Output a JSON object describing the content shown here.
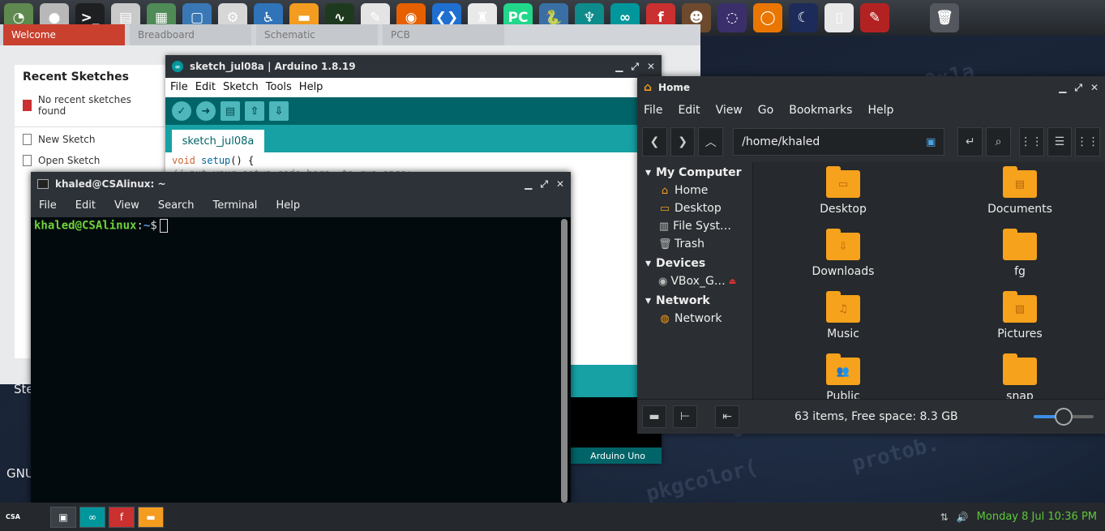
{
  "launcher": {
    "icons": [
      {
        "name": "disk-usage-icon",
        "bg": "#5f8a4f",
        "glyph": "◔"
      },
      {
        "name": "browser-ball-icon",
        "bg": "#b8b8b8",
        "glyph": "●"
      },
      {
        "name": "terminal-app-icon",
        "bg": "#1d1f21",
        "glyph": ">_"
      },
      {
        "name": "file-cabinet-icon",
        "bg": "#c9c9c9",
        "glyph": "▤"
      },
      {
        "name": "calculator-icon",
        "bg": "#4f8a57",
        "glyph": "▦"
      },
      {
        "name": "screenshot-icon",
        "bg": "#3a78b5",
        "glyph": "▢"
      },
      {
        "name": "mixer-icon",
        "bg": "#d7d7d7",
        "glyph": "⚙"
      },
      {
        "name": "accessibility-icon",
        "bg": "#2f73b8",
        "glyph": "♿"
      },
      {
        "name": "folder-app-icon",
        "bg": "#f39c1f",
        "glyph": "▬"
      },
      {
        "name": "system-monitor-icon",
        "bg": "#1e3a1e",
        "glyph": "∿"
      },
      {
        "name": "text-editor-icon",
        "bg": "#e4e4e4",
        "glyph": "✎"
      },
      {
        "name": "firefox-icon",
        "bg": "#e66000",
        "glyph": "◉"
      },
      {
        "name": "vscode-icon",
        "bg": "#1f6fd1",
        "glyph": "❮❯"
      },
      {
        "name": "java-duke-icon",
        "bg": "#e9e9e9",
        "glyph": "♜"
      },
      {
        "name": "pycharm-icon",
        "bg": "#21d789",
        "glyph": "PC"
      },
      {
        "name": "python-icon",
        "bg": "#3a6fa6",
        "glyph": "🐍"
      },
      {
        "name": "kraken-icon",
        "bg": "#0e8b8b",
        "glyph": "♆"
      },
      {
        "name": "arduino-app-icon",
        "bg": "#00979c",
        "glyph": "∞"
      },
      {
        "name": "fritzing-app-icon",
        "bg": "#c9302f",
        "glyph": "f"
      },
      {
        "name": "gnu-emacs-icon",
        "bg": "#6d4a2d",
        "glyph": "☻"
      },
      {
        "name": "node-graph-icon",
        "bg": "#3a2f6b",
        "glyph": "◌"
      },
      {
        "name": "blender-like-icon",
        "bg": "#ea7600",
        "glyph": "◯"
      },
      {
        "name": "stellarium-icon",
        "bg": "#1c2b5a",
        "glyph": "☾"
      },
      {
        "name": "blank-document-icon",
        "bg": "#e8e8e8",
        "glyph": "▯"
      },
      {
        "name": "paint-icon",
        "bg": "#b32222",
        "glyph": "✎"
      },
      {
        "name": "trash-launcher-icon",
        "bg": "#54585e",
        "glyph": "🗑"
      }
    ]
  },
  "fritzing": {
    "tabs": [
      "Welcome",
      "Breadboard",
      "Schematic",
      "PCB"
    ],
    "recent_title": "Recent Sketches",
    "no_recent": "No recent sketches found",
    "new_sketch": "New Sketch",
    "open_sketch": "Open Sketch"
  },
  "arduino": {
    "title": "sketch_jul08a | Arduino 1.8.19",
    "menu": [
      "File",
      "Edit",
      "Sketch",
      "Tools",
      "Help"
    ],
    "tab_name": "sketch_jul08a",
    "code_line1_kw": "void",
    "code_line1_fn": "setup",
    "code_line1_rest": "() {",
    "code_line2": "  // put your setup code here, to run once:",
    "board": "Arduino Uno"
  },
  "terminal": {
    "title": "khaled@CSAlinux: ~",
    "menu": [
      "File",
      "Edit",
      "View",
      "Search",
      "Terminal",
      "Help"
    ],
    "prompt_user": "khaled@CSAlinux",
    "prompt_sep": ":",
    "prompt_path": "~",
    "prompt_dollar": "$"
  },
  "files": {
    "title": "Home",
    "menu": [
      "File",
      "Edit",
      "View",
      "Go",
      "Bookmarks",
      "Help"
    ],
    "path": "/home/khaled",
    "sections": {
      "my_computer": "My Computer",
      "devices": "Devices",
      "network": "Network"
    },
    "computer_items": [
      "Home",
      "Desktop",
      "File Syst…",
      "Trash"
    ],
    "device_items": [
      "VBox_G…"
    ],
    "network_items": [
      "Network"
    ],
    "folders": [
      {
        "label": "Desktop",
        "glyph": "▭"
      },
      {
        "label": "Documents",
        "glyph": "▤"
      },
      {
        "label": "Downloads",
        "glyph": "⇩"
      },
      {
        "label": "fg",
        "glyph": ""
      },
      {
        "label": "Music",
        "glyph": "♫"
      },
      {
        "label": "Pictures",
        "glyph": "▨"
      },
      {
        "label": "Public",
        "glyph": "👥"
      },
      {
        "label": "snap",
        "glyph": ""
      }
    ],
    "status": "63 items, Free space: 8.3 GB",
    "zoom_level": 0.5
  },
  "taskbar": {
    "logo": "CSA",
    "clock": "Monday  8 Jul 10:36 PM"
  },
  "desktop_text": {
    "ste": "Ste",
    "gnu": "GNU"
  },
  "colors": {
    "arduino_teal": "#17a1a5",
    "arduino_dark_teal": "#006468",
    "folder_orange": "#f7a21c",
    "prompt_green": "#6fd33a",
    "prompt_blue": "#5b9ce6",
    "clock_green": "#5fc83a"
  }
}
